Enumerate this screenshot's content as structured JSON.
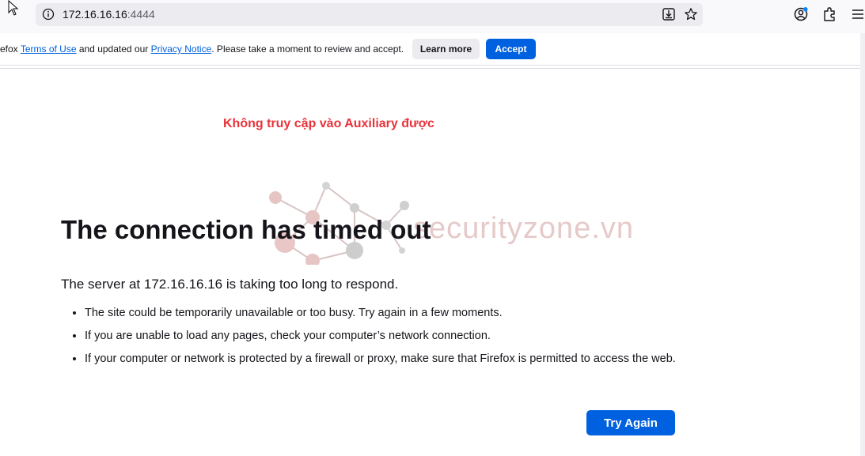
{
  "toolbar": {
    "url_host": "172.16.16.16",
    "url_port": ":4444"
  },
  "notice": {
    "prefix": "efox ",
    "terms_link": "Terms of Use",
    "middle": " and updated our ",
    "privacy_link": "Privacy Notice",
    "suffix": ". Please take a moment to review and accept.",
    "learn_more": "Learn more",
    "accept": "Accept"
  },
  "annotation": {
    "text": "Không truy cập vào Auxiliary được",
    "color": "#e8333a"
  },
  "watermark": {
    "text": "securityzone.vn"
  },
  "error": {
    "title": "The connection has timed out",
    "description": "The server at 172.16.16.16 is taking too long to respond.",
    "tips": [
      "The site could be temporarily unavailable or too busy. Try again in a few moments.",
      "If you are unable to load any pages, check your computer’s network connection.",
      "If your computer or network is protected by a firewall or proxy, make sure that Firefox is permitted to access the web."
    ],
    "try_again": "Try Again"
  },
  "colors": {
    "accent": "#0061e0",
    "annotation": "#e8333a"
  },
  "icons": [
    "cursor-icon",
    "info-icon",
    "download-icon",
    "star-icon",
    "account-icon",
    "extensions-icon",
    "menu-icon"
  ]
}
